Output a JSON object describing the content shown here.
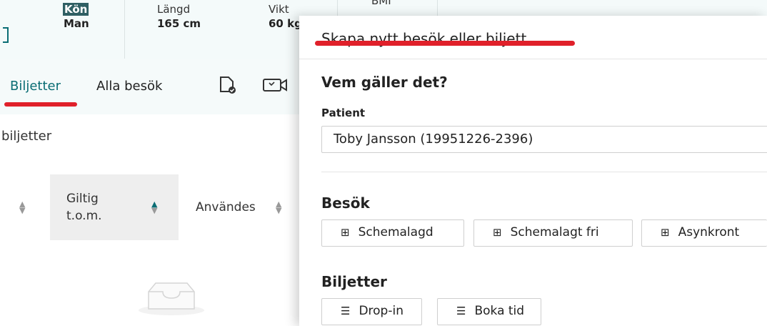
{
  "patient_info": {
    "kon": {
      "label": "Kön",
      "value": "Man"
    },
    "langd": {
      "label": "Längd",
      "value": "165 cm"
    },
    "vikt": {
      "label": "Vikt",
      "value": "60 kg"
    },
    "bmi": {
      "label": "BMI"
    }
  },
  "nav": {
    "tabs": [
      {
        "label": "Biljetter",
        "active": true
      },
      {
        "label": "Alla besök",
        "active": false
      }
    ],
    "icons": [
      "document-check-icon",
      "video-icon"
    ]
  },
  "section": {
    "label": "biljetter"
  },
  "table": {
    "columns": [
      {
        "label": ""
      },
      {
        "label": "Giltig t.o.m."
      },
      {
        "label": "Användes"
      }
    ]
  },
  "panel": {
    "title": "Skapa nytt besök eller biljett",
    "who_heading": "Vem gäller det?",
    "patient_label": "Patient",
    "patient_value": "Toby Jansson (19951226-2396)",
    "visits_heading": "Besök",
    "visit_buttons": [
      "Schemalagd",
      "Schemalagt fri",
      "Asynkront"
    ],
    "tickets_heading": "Biljetter",
    "ticket_buttons": [
      "Drop-in",
      "Boka tid"
    ]
  },
  "colors": {
    "accent": "#0a6d74",
    "annotation_red": "#e0202a"
  }
}
